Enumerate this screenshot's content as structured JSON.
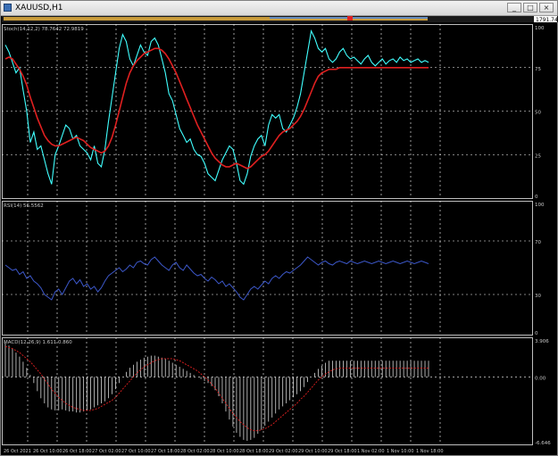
{
  "window": {
    "title": "XAUUSD,H1",
    "min_label": "_",
    "max_label": "□",
    "close_label": "×"
  },
  "price_label": "1791.74",
  "panes": [
    {
      "key": "stoch",
      "label": "Stoch(14,12,2) 78.7642 72.9819",
      "levels": [
        {
          "v": 100,
          "t": "100"
        },
        {
          "v": 75,
          "t": "75"
        },
        {
          "v": 50,
          "t": "50"
        },
        {
          "v": 25,
          "t": "25"
        },
        {
          "v": 0,
          "t": "0"
        }
      ]
    },
    {
      "key": "rsi",
      "label": "RSI(14) 56.5562",
      "levels": [
        {
          "v": 100,
          "t": "100"
        },
        {
          "v": 70,
          "t": "70"
        },
        {
          "v": 30,
          "t": "30"
        },
        {
          "v": 0,
          "t": "0"
        }
      ]
    },
    {
      "key": "macd",
      "label": "MACD(12,26,9) 1.611 0.860",
      "levels": [
        {
          "v": 3.906,
          "t": "3.906"
        },
        {
          "v": 0,
          "t": "0.00"
        },
        {
          "v": -6.646,
          "t": "-6.646"
        }
      ]
    }
  ],
  "time_labels": [
    "26 Oct 2021",
    "26 Oct 10:00",
    "26 Oct 18:00",
    "27 Oct 02:00",
    "27 Oct 10:00",
    "27 Oct 18:00",
    "28 Oct 02:00",
    "28 Oct 10:00",
    "28 Oct 18:00",
    "29 Oct 02:00",
    "29 Oct 10:00",
    "29 Oct 18:00",
    "1 Nov 02:00",
    "1 Nov 10:00",
    "1 Nov 18:00"
  ],
  "colors": {
    "stoch_main": "#40ffff",
    "stoch_signal": "#e02020",
    "rsi": "#3c57c8",
    "macd_hist": "#d8d8d8",
    "macd_signal": "#e02020",
    "grid": "#ffffff",
    "text": "#c8c8c8"
  },
  "chart_data": [
    {
      "type": "line",
      "name": "Stochastic",
      "ylim": [
        0,
        100
      ],
      "x": [
        0,
        1,
        2,
        3,
        4,
        5,
        6,
        7,
        8,
        9,
        10,
        11,
        12,
        13,
        14,
        15,
        16,
        17,
        18,
        19,
        20,
        21,
        22,
        23,
        24,
        25,
        26,
        27,
        28,
        29,
        30,
        31,
        32,
        33,
        34,
        35,
        36,
        37,
        38,
        39,
        40,
        41,
        42,
        43,
        44,
        45,
        46,
        47,
        48,
        49,
        50,
        51,
        52,
        53,
        54,
        55,
        56,
        57,
        58,
        59,
        60,
        61,
        62,
        63,
        64,
        65,
        66,
        67,
        68,
        69,
        70,
        71,
        72,
        73,
        74,
        75,
        76,
        77,
        78,
        79,
        80,
        81,
        82,
        83,
        84,
        85,
        86,
        87,
        88,
        89,
        90,
        91,
        92,
        93,
        94,
        95,
        96,
        97,
        98,
        99,
        100,
        101,
        102,
        103,
        104,
        105,
        106,
        107,
        108,
        109,
        110,
        111,
        112,
        113,
        114,
        115,
        116,
        117,
        118,
        119
      ],
      "series": [
        {
          "values": [
            88,
            84,
            78,
            72,
            75,
            62,
            50,
            32,
            38,
            28,
            30,
            22,
            14,
            8,
            25,
            30,
            36,
            42,
            40,
            34,
            36,
            30,
            28,
            26,
            22,
            30,
            20,
            18,
            28,
            44,
            58,
            72,
            86,
            94,
            90,
            80,
            76,
            82,
            88,
            84,
            82,
            90,
            92,
            88,
            80,
            72,
            60,
            56,
            48,
            40,
            36,
            32,
            34,
            28,
            25,
            24,
            20,
            14,
            12,
            10,
            16,
            22,
            26,
            30,
            28,
            20,
            10,
            8,
            14,
            24,
            30,
            34,
            36,
            30,
            42,
            48,
            46,
            48,
            40,
            38,
            42,
            46,
            52,
            60,
            72,
            84,
            96,
            92,
            86,
            84,
            86,
            80,
            78,
            80,
            84,
            86,
            82,
            80,
            81,
            79,
            77,
            80,
            82,
            78,
            76,
            78,
            80,
            77,
            79,
            80,
            78,
            81,
            79,
            80,
            78,
            79,
            80,
            78,
            79,
            78
          ]
        },
        {
          "values": [
            80,
            81,
            80,
            77,
            74,
            70,
            65,
            58,
            52,
            46,
            41,
            36,
            33,
            31,
            30,
            30,
            31,
            32,
            33,
            34,
            35,
            34,
            33,
            31,
            29,
            28,
            27,
            26,
            27,
            30,
            35,
            42,
            50,
            58,
            66,
            72,
            76,
            79,
            81,
            83,
            84,
            85,
            86,
            86,
            85,
            83,
            80,
            76,
            72,
            67,
            62,
            57,
            52,
            47,
            42,
            38,
            34,
            30,
            26,
            23,
            21,
            19,
            18,
            18,
            19,
            20,
            19,
            18,
            17,
            18,
            20,
            22,
            24,
            25,
            27,
            30,
            33,
            36,
            38,
            39,
            40,
            42,
            44,
            47,
            51,
            56,
            61,
            66,
            70,
            72,
            73,
            74,
            74,
            74,
            75,
            75,
            75,
            75,
            75,
            75,
            75,
            75,
            75,
            75,
            75,
            75,
            75,
            75,
            75,
            75,
            75,
            75,
            75,
            75,
            75,
            75,
            75,
            75,
            75,
            75
          ]
        }
      ]
    },
    {
      "type": "line",
      "name": "RSI",
      "ylim": [
        0,
        100
      ],
      "series": [
        {
          "values": [
            52,
            50,
            48,
            49,
            45,
            47,
            42,
            44,
            40,
            38,
            35,
            30,
            28,
            26,
            32,
            34,
            30,
            35,
            40,
            42,
            38,
            41,
            36,
            38,
            34,
            36,
            32,
            35,
            40,
            44,
            46,
            48,
            50,
            47,
            49,
            52,
            50,
            54,
            55,
            53,
            52,
            56,
            58,
            55,
            52,
            50,
            48,
            52,
            54,
            50,
            48,
            52,
            49,
            46,
            44,
            45,
            42,
            40,
            43,
            41,
            38,
            40,
            36,
            38,
            35,
            32,
            28,
            26,
            30,
            34,
            36,
            34,
            37,
            40,
            38,
            42,
            44,
            42,
            45,
            47,
            46,
            48,
            50,
            52,
            55,
            58,
            56,
            54,
            52,
            54,
            55,
            53,
            52,
            54,
            55,
            54,
            53,
            55,
            54,
            53,
            54,
            55,
            54,
            53,
            54,
            55,
            54,
            53,
            54,
            55,
            54,
            53,
            54,
            55,
            54,
            53,
            54,
            55,
            54,
            53
          ]
        }
      ]
    },
    {
      "type": "bar",
      "name": "MACD",
      "ylim": [
        -6.646,
        3.906
      ],
      "series": [
        {
          "name": "MACD",
          "values": [
            3.4,
            3.1,
            2.8,
            2.4,
            2.0,
            1.5,
            0.9,
            0.2,
            -0.6,
            -1.4,
            -2.1,
            -2.6,
            -3.0,
            -3.2,
            -3.3,
            -3.3,
            -3.2,
            -3.3,
            -3.4,
            -3.4,
            -3.5,
            -3.5,
            -3.4,
            -3.3,
            -3.2,
            -3.0,
            -2.8,
            -2.6,
            -2.4,
            -2.1,
            -1.7,
            -1.2,
            -0.6,
            0.0,
            0.5,
            0.9,
            1.2,
            1.5,
            1.7,
            1.9,
            2.0,
            2.1,
            2.1,
            2.0,
            1.9,
            1.8,
            1.6,
            1.4,
            1.2,
            1.0,
            0.8,
            0.6,
            0.4,
            0.2,
            0.0,
            -0.2,
            -0.4,
            -0.6,
            -0.9,
            -1.3,
            -1.9,
            -2.6,
            -3.4,
            -4.2,
            -4.9,
            -5.5,
            -5.9,
            -6.2,
            -6.3,
            -6.2,
            -6.0,
            -5.6,
            -5.2,
            -4.8,
            -4.4,
            -4.0,
            -3.6,
            -3.2,
            -2.9,
            -2.6,
            -2.3,
            -2.0,
            -1.7,
            -1.4,
            -1.0,
            -0.5,
            0.0,
            0.4,
            0.8,
            1.1,
            1.4,
            1.6,
            1.6,
            1.6,
            1.6,
            1.6,
            1.6,
            1.6,
            1.6,
            1.6,
            1.6,
            1.6,
            1.6,
            1.6,
            1.6,
            1.6,
            1.6,
            1.6,
            1.6,
            1.6,
            1.6,
            1.6,
            1.6,
            1.6,
            1.6,
            1.6,
            1.6,
            1.6,
            1.6,
            1.6
          ]
        },
        {
          "name": "Signal",
          "values": [
            3.0,
            2.9,
            2.8,
            2.6,
            2.4,
            2.1,
            1.8,
            1.5,
            1.1,
            0.7,
            0.3,
            -0.2,
            -0.7,
            -1.2,
            -1.6,
            -2.0,
            -2.3,
            -2.6,
            -2.8,
            -3.0,
            -3.1,
            -3.2,
            -3.3,
            -3.3,
            -3.3,
            -3.2,
            -3.1,
            -2.9,
            -2.7,
            -2.5,
            -2.3,
            -2.0,
            -1.6,
            -1.2,
            -0.8,
            -0.4,
            0.0,
            0.4,
            0.7,
            1.0,
            1.2,
            1.4,
            1.6,
            1.7,
            1.8,
            1.8,
            1.8,
            1.8,
            1.7,
            1.6,
            1.4,
            1.2,
            1.0,
            0.8,
            0.6,
            0.3,
            0.0,
            -0.3,
            -0.7,
            -1.1,
            -1.6,
            -2.1,
            -2.6,
            -3.1,
            -3.6,
            -4.0,
            -4.4,
            -4.7,
            -5.0,
            -5.2,
            -5.3,
            -5.3,
            -5.2,
            -5.1,
            -4.9,
            -4.7,
            -4.4,
            -4.1,
            -3.8,
            -3.5,
            -3.2,
            -2.9,
            -2.6,
            -2.2,
            -1.9,
            -1.5,
            -1.1,
            -0.7,
            -0.3,
            0.0,
            0.3,
            0.5,
            0.7,
            0.8,
            0.86,
            0.86,
            0.86,
            0.86,
            0.86,
            0.86,
            0.86,
            0.86,
            0.86,
            0.86,
            0.86,
            0.86,
            0.86,
            0.86,
            0.86,
            0.86,
            0.86,
            0.86,
            0.86,
            0.86,
            0.86,
            0.86,
            0.86,
            0.86,
            0.86,
            0.86
          ]
        }
      ]
    }
  ]
}
